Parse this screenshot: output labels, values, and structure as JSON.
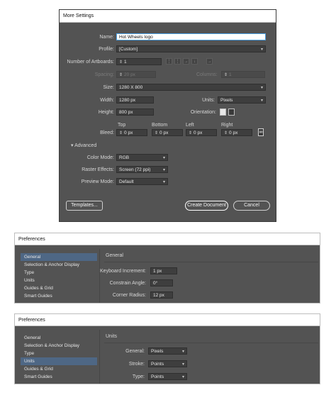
{
  "more_settings": {
    "title": "More Settings",
    "name_label": "Name:",
    "name_value": "Hot Wheels logo",
    "profile_label": "Profile:",
    "profile_value": "[Custom]",
    "artboards_label": "Number of Artboards:",
    "artboards_value": "1",
    "spacing_label": "Spacing:",
    "spacing_value": "20 px",
    "columns_label": "Columns:",
    "columns_value": "1",
    "size_label": "Size:",
    "size_value": "1280 X 800",
    "width_label": "Width:",
    "width_value": "1280 px",
    "units_label": "Units:",
    "units_value": "Pixels",
    "height_label": "Height:",
    "height_value": "800 px",
    "orientation_label": "Orientation:",
    "bleed_label": "Bleed:",
    "bleed_top_label": "Top",
    "bleed_bottom_label": "Bottom",
    "bleed_left_label": "Left",
    "bleed_right_label": "Right",
    "bleed_top": "0 px",
    "bleed_bottom": "0 px",
    "bleed_left": "0 px",
    "bleed_right": "0 px",
    "advanced_label": "Advanced",
    "color_mode_label": "Color Mode:",
    "color_mode_value": "RGB",
    "raster_label": "Raster Effects:",
    "raster_value": "Screen (72 ppi)",
    "preview_label": "Preview Mode:",
    "preview_value": "Default",
    "templates_button": "Templates...",
    "create_button": "Create Document",
    "cancel_button": "Cancel"
  },
  "prefs_general": {
    "title": "Preferences",
    "sidebar": [
      "General",
      "Selection & Anchor Display",
      "Type",
      "Units",
      "Guides & Grid",
      "Smart Guides"
    ],
    "selected_index": 0,
    "heading": "General",
    "keyboard_label": "Keyboard Increment:",
    "keyboard_value": "1 px",
    "angle_label": "Constrain Angle:",
    "angle_value": "0°",
    "radius_label": "Corner Radius:",
    "radius_value": "12 px"
  },
  "prefs_units": {
    "title": "Preferences",
    "sidebar": [
      "General",
      "Selection & Anchor Display",
      "Type",
      "Units",
      "Guides & Grid",
      "Smart Guides"
    ],
    "selected_index": 3,
    "heading": "Units",
    "general_label": "General:",
    "general_value": "Pixels",
    "stroke_label": "Stroke:",
    "stroke_value": "Points",
    "type_label": "Type:",
    "type_value": "Points"
  },
  "colors": {
    "panel": "#535353",
    "field": "#3e3e3e",
    "selected_item": "#4e6785",
    "name_focus": "#4aa0e6"
  }
}
